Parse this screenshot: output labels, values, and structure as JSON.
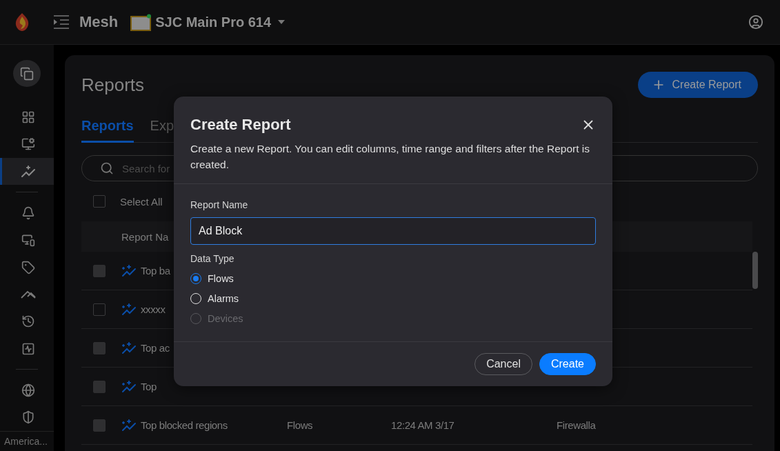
{
  "topbar": {
    "app_title": "Mesh",
    "device": {
      "name": "SJC Main Pro 614",
      "online": true
    }
  },
  "sidebar": {
    "items": [
      {
        "selected": false
      },
      {
        "selected": false
      },
      {
        "selected": true
      },
      {
        "selected": false
      },
      {
        "selected": false
      },
      {
        "selected": false
      },
      {
        "selected": false
      },
      {
        "selected": false
      },
      {
        "selected": false
      },
      {
        "selected": false
      },
      {
        "selected": false
      }
    ],
    "footer": "America..."
  },
  "page": {
    "title": "Reports",
    "create_button": "Create Report",
    "tabs": [
      {
        "label": "Reports",
        "selected": true
      },
      {
        "label": "Exp",
        "selected": false
      }
    ],
    "search": {
      "placeholder": "Search for"
    },
    "select_all": {
      "label": "Select All",
      "checked": false
    },
    "table": {
      "columns": [
        "Report Na"
      ],
      "rows": [
        {
          "name": "Top ba",
          "disabled": true
        },
        {
          "name": "xxxxx",
          "disabled": false
        },
        {
          "name": "Top ac",
          "disabled": true
        },
        {
          "name": "Top",
          "disabled": true
        },
        {
          "name": "Top blocked regions",
          "type": "Flows",
          "time": "12:24 AM 3/17",
          "source": "Firewalla",
          "disabled": true
        }
      ]
    }
  },
  "dialog": {
    "title": "Create Report",
    "description": "Create a new Report. You can edit columns, time range and filters after the Report is created.",
    "name_label": "Report Name",
    "name_value": "Ad Block",
    "type_label": "Data Type",
    "options": [
      {
        "label": "Flows",
        "selected": true,
        "disabled": false
      },
      {
        "label": "Alarms",
        "selected": false,
        "disabled": false
      },
      {
        "label": "Devices",
        "selected": false,
        "disabled": true
      }
    ],
    "buttons": [
      {
        "label": "Cancel",
        "kind": "secondary"
      },
      {
        "label": "Create",
        "kind": "primary"
      }
    ]
  }
}
